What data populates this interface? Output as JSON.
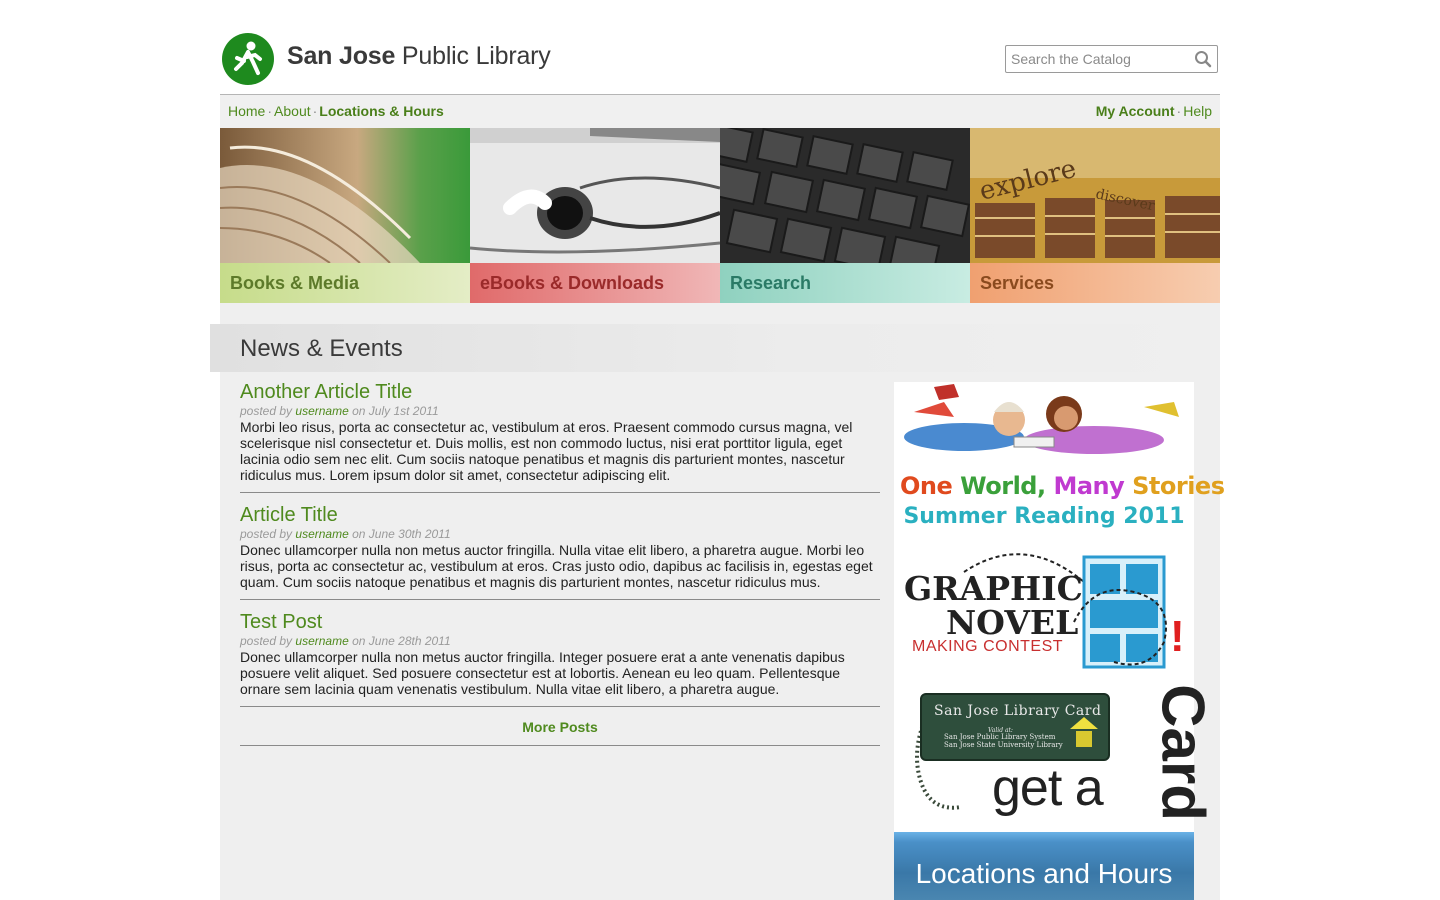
{
  "header": {
    "title_bold": "San Jose",
    "title_rest": " Public Library",
    "search_placeholder": "Search the Catalog"
  },
  "nav": {
    "left": [
      {
        "label": "Home",
        "bold": false
      },
      {
        "label": "About",
        "bold": false
      },
      {
        "label": "Locations & Hours",
        "bold": true
      }
    ],
    "right": [
      {
        "label": "My Account",
        "bold": true
      },
      {
        "label": "Help",
        "bold": false
      }
    ],
    "separator": "·"
  },
  "tiles": [
    {
      "label": "Books & Media"
    },
    {
      "label": "eBooks & Downloads"
    },
    {
      "label": "Research"
    },
    {
      "label": "Services"
    }
  ],
  "news": {
    "heading": "News & Events",
    "articles": [
      {
        "title": "Another Article Title",
        "posted_by": "posted by",
        "user": "username",
        "on_date": "on July 1st 2011",
        "body": "Morbi leo risus, porta ac consectetur ac, vestibulum at eros. Praesent commodo cursus magna, vel scelerisque nisl consectetur et. Duis mollis, est non commodo luctus, nisi erat porttitor ligula, eget lacinia odio sem nec elit. Cum sociis natoque penatibus et magnis dis parturient montes, nascetur ridiculus mus. Lorem ipsum dolor sit amet, consectetur adipiscing elit."
      },
      {
        "title": "Article Title",
        "posted_by": "posted by",
        "user": "username",
        "on_date": "on June 30th 2011",
        "body": "Donec ullamcorper nulla non metus auctor fringilla. Nulla vitae elit libero, a pharetra augue. Morbi leo risus, porta ac consectetur ac, vestibulum at eros. Cras justo odio, dapibus ac facilisis in, egestas eget quam. Cum sociis natoque penatibus et magnis dis parturient montes, nascetur ridiculus mus."
      },
      {
        "title": "Test Post",
        "posted_by": "posted by",
        "user": "username",
        "on_date": "on June 28th 2011",
        "body": "Donec ullamcorper nulla non metus auctor fringilla. Integer posuere erat a ante venenatis dapibus posuere velit aliquet. Sed posuere consectetur est at lobortis. Aenean eu leo quam. Pellentesque ornare sem lacinia quam venenatis vestibulum. Nulla vitae elit libero, a pharetra augue."
      }
    ],
    "more_label": "More Posts"
  },
  "sidebar": {
    "owms": [
      "One ",
      "World, ",
      "Many ",
      "Stories"
    ],
    "summer": "Summer Reading 2011",
    "gn_line1": "GRAPHIC",
    "gn_line2": "NOVEL",
    "gn_contest": "MAKING CONTEST",
    "gn_excl": "!",
    "card_title": "San Jose Library Card",
    "card_valid": "Valid at:",
    "card_line1": "San Jose Public Library System",
    "card_line2": "San Jose State University Library",
    "get_a": "get a",
    "card_word": "Card",
    "locations": "Locations and Hours"
  },
  "colors": {
    "link_green": "#4f8a1e",
    "logo_green": "#1e8a1e",
    "content_bg": "#efefef"
  }
}
